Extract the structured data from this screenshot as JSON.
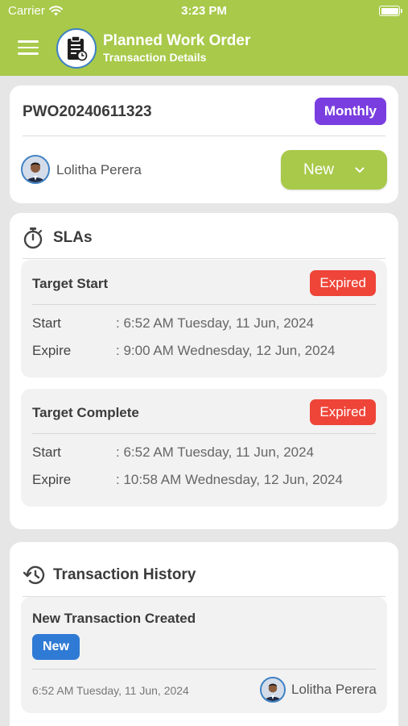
{
  "status_bar": {
    "carrier": "Carrier",
    "time": "3:23 PM"
  },
  "header": {
    "title": "Planned Work Order",
    "subtitle": "Transaction Details"
  },
  "work_order": {
    "number": "PWO20240611323",
    "frequency_badge": "Monthly",
    "user_name": "Lolitha Perera",
    "status_value": "New"
  },
  "slas": {
    "title": "SLAs",
    "items": [
      {
        "title": "Target Start",
        "badge": "Expired",
        "start_label": "Start",
        "start_value": ": 6:52 AM Tuesday, 11 Jun, 2024",
        "expire_label": "Expire",
        "expire_value": ": 9:00 AM Wednesday, 12 Jun, 2024"
      },
      {
        "title": "Target Complete",
        "badge": "Expired",
        "start_label": "Start",
        "start_value": ": 6:52 AM Tuesday, 11 Jun, 2024",
        "expire_label": "Expire",
        "expire_value": ": 10:58 AM Wednesday, 12 Jun, 2024"
      }
    ]
  },
  "history": {
    "title": "Transaction History",
    "items": [
      {
        "title": "New Transaction Created",
        "badge": "New",
        "date": "6:52 AM Tuesday, 11 Jun, 2024",
        "user_name": "Lolitha Perera"
      }
    ]
  },
  "colors": {
    "header_green": "#a8c94a",
    "monthly_purple": "#7a3ee0",
    "expired_red": "#ef4438",
    "new_blue": "#2f7ad4"
  },
  "icons": [
    "wifi-icon",
    "battery-icon",
    "menu-icon",
    "work-order-logo-icon",
    "chevron-down-icon",
    "stopwatch-icon",
    "history-icon"
  ]
}
